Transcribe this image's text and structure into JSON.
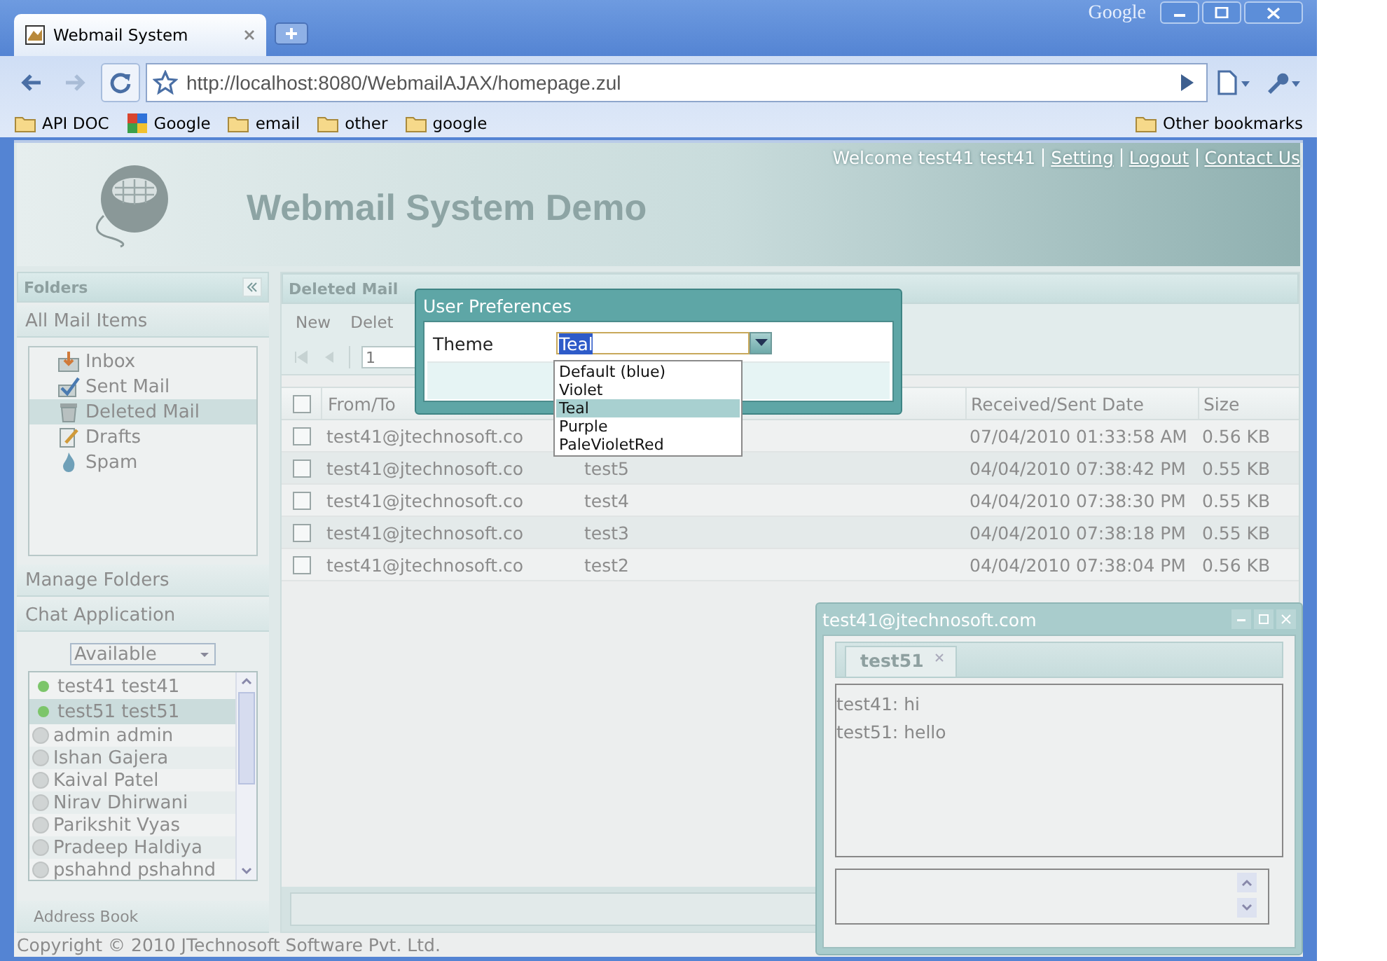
{
  "browser": {
    "tab_title": "Webmail System",
    "brand": "Google",
    "url": "http://localhost:8080/WebmailAJAX/homepage.zul",
    "bookmarks": [
      {
        "label": "API DOC",
        "kind": "folder"
      },
      {
        "label": "Google",
        "kind": "site"
      },
      {
        "label": "email",
        "kind": "folder"
      },
      {
        "label": "other",
        "kind": "folder"
      },
      {
        "label": "google",
        "kind": "folder"
      }
    ],
    "other_bookmarks": "Other bookmarks"
  },
  "header": {
    "title": "Webmail System Demo",
    "welcome": "Welcome test41 test41",
    "links": [
      "Setting",
      "Logout",
      "Contact Us"
    ]
  },
  "sidebar": {
    "title": "Folders",
    "all_mail": "All Mail Items",
    "folders": [
      {
        "label": "Inbox",
        "kind": "inbox",
        "selected": false
      },
      {
        "label": "Sent Mail",
        "kind": "sent",
        "selected": false
      },
      {
        "label": "Deleted Mail",
        "kind": "trash",
        "selected": true
      },
      {
        "label": "Drafts",
        "kind": "drafts",
        "selected": false
      },
      {
        "label": "Spam",
        "kind": "spam",
        "selected": false
      }
    ],
    "manage": "Manage Folders",
    "chat_title": "Chat Application",
    "status": "Available",
    "contacts": [
      {
        "name": "test41 test41",
        "online": true,
        "selected": false
      },
      {
        "name": "test51 test51",
        "online": true,
        "selected": true
      },
      {
        "name": "admin admin",
        "online": false,
        "selected": false
      },
      {
        "name": "Ishan Gajera",
        "online": false,
        "selected": false
      },
      {
        "name": "Kaival Patel",
        "online": false,
        "selected": false
      },
      {
        "name": "Nirav Dhirwani",
        "online": false,
        "selected": false
      },
      {
        "name": "Parikshit Vyas",
        "online": false,
        "selected": false
      },
      {
        "name": "Pradeep Haldiya",
        "online": false,
        "selected": false
      },
      {
        "name": "pshahnd pshahnd",
        "online": false,
        "selected": false
      }
    ],
    "address_book": "Address Book"
  },
  "main": {
    "title": "Deleted Mail",
    "toolbar": [
      "New",
      "Delet"
    ],
    "page": "1",
    "columns": [
      "From/To",
      "Received/Sent Date",
      "Size"
    ],
    "select_all_checked": false,
    "rows": [
      {
        "from": "test41@jtechnosoft.co",
        "date": "07/04/2010 01:33:58 AM",
        "size": "0.56 KB",
        "checked": false
      },
      {
        "from": "test41@jtechnosoft.co",
        "subject": "test5",
        "date": "04/04/2010 07:38:42 PM",
        "size": "0.55 KB",
        "checked": false
      },
      {
        "from": "test41@jtechnosoft.co",
        "subject": "test4",
        "date": "04/04/2010 07:38:30 PM",
        "size": "0.55 KB",
        "checked": false
      },
      {
        "from": "test41@jtechnosoft.co",
        "subject": "test3",
        "date": "04/04/2010 07:38:18 PM",
        "size": "0.55 KB",
        "checked": false
      },
      {
        "from": "test41@jtechnosoft.co",
        "subject": "test2",
        "date": "04/04/2010 07:38:04 PM",
        "size": "0.56 KB",
        "checked": false
      }
    ]
  },
  "dialog": {
    "title": "User Preferences",
    "label": "Theme",
    "value": "Teal",
    "options": [
      {
        "label": "Default (blue)",
        "selected": false
      },
      {
        "label": "Violet",
        "selected": false
      },
      {
        "label": "Teal",
        "selected": true
      },
      {
        "label": "Purple",
        "selected": false
      },
      {
        "label": "PaleVioletRed",
        "selected": false
      }
    ]
  },
  "chat": {
    "title": "test41@jtechnosoft.com",
    "tab": "test51",
    "messages": [
      "test41: hi",
      "test51: hello"
    ]
  },
  "footer": "Copyright © 2010 JTechnosoft Software Pvt. Ltd."
}
